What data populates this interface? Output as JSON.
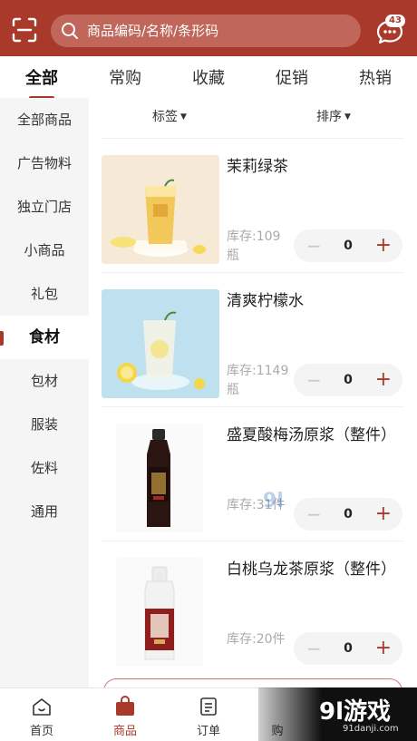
{
  "header": {
    "search_placeholder": "商品编码/名称/条形码",
    "message_count": "43"
  },
  "tabs": [
    "全部",
    "常购",
    "收藏",
    "促销",
    "热销"
  ],
  "sidebar": [
    "全部商品",
    "广告物料",
    "独立门店",
    "小商品",
    "礼包",
    "食材",
    "包材",
    "服装",
    "佐料",
    "通用"
  ],
  "filters": {
    "tag_label": "标签",
    "sort_label": "排序"
  },
  "products": [
    {
      "name": "茉莉绿茶",
      "stock": "库存:109瓶",
      "qty": "0"
    },
    {
      "name": "清爽柠檬水",
      "stock": "库存:1149瓶",
      "qty": "0"
    },
    {
      "name": "盛夏酸梅汤原浆（整件）",
      "stock": "库存:31件",
      "qty": "0"
    },
    {
      "name": "白桃乌龙茶原浆（整件）",
      "stock": "库存:20件",
      "qty": "0"
    }
  ],
  "stepper": {
    "minus": "−",
    "plus": "+"
  },
  "bottom_nav": [
    "首页",
    "商品",
    "订单",
    "购"
  ],
  "watermark": {
    "logo": "9l游戏",
    "url": "91danji.com"
  },
  "colors": {
    "brand": "#a93a2b"
  }
}
